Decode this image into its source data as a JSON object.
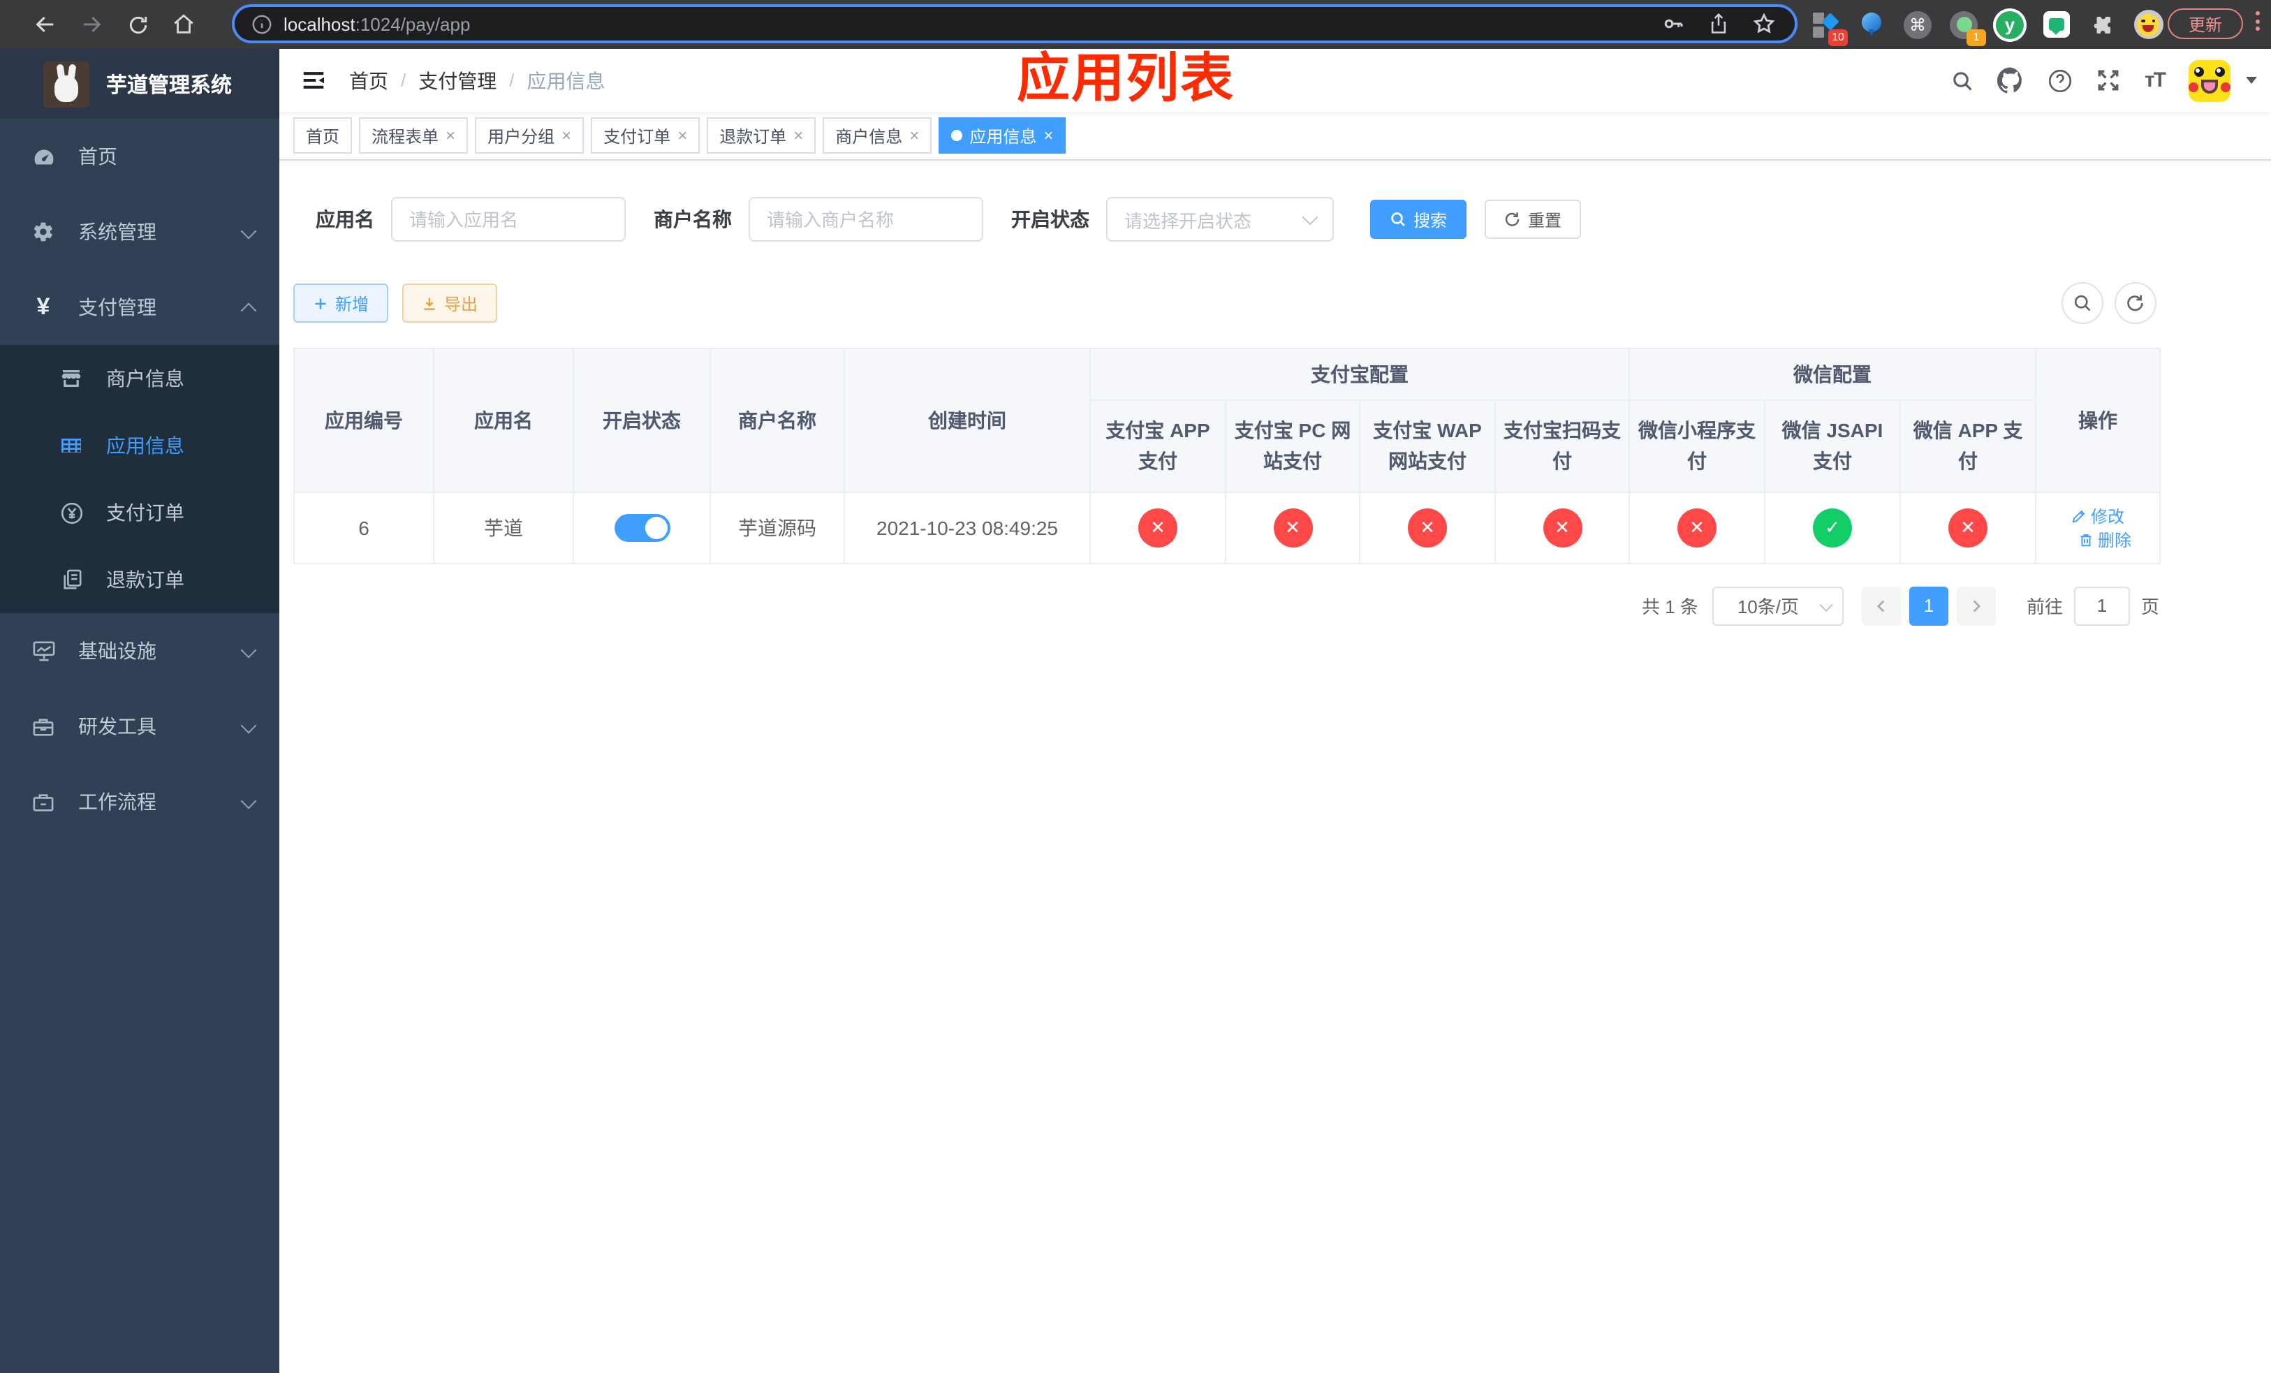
{
  "colors": {
    "accent": "#409eff",
    "success": "#13ce66",
    "danger": "#ff4949",
    "warning": "#e6a23c",
    "annotation_red": "#ff2b00",
    "sidebar_bg": "#304156",
    "submenu_bg": "#1f2d3d"
  },
  "icons": {
    "close": "×",
    "check": "✓",
    "cross": "✕",
    "cmd": "⌘",
    "y_logo": "y",
    "yuan": "¥",
    "question": "?",
    "font_size": "тT",
    "info": "i"
  },
  "browser": {
    "url": {
      "host": "localhost",
      "path": ":1024/pay/app"
    },
    "update_button": "更新",
    "extension_badge_1": "10",
    "extension_badge_2": "1"
  },
  "sidebar": {
    "title": "芋道管理系统",
    "items": [
      {
        "label": "首页"
      },
      {
        "label": "系统管理"
      },
      {
        "label": "支付管理"
      },
      {
        "label": "商户信息"
      },
      {
        "label": "应用信息"
      },
      {
        "label": "支付订单"
      },
      {
        "label": "退款订单"
      },
      {
        "label": "基础设施"
      },
      {
        "label": "研发工具"
      },
      {
        "label": "工作流程"
      }
    ]
  },
  "navbar": {
    "breadcrumb": [
      "首页",
      "支付管理",
      "应用信息"
    ],
    "separator": "/"
  },
  "annotation": "应用列表",
  "tabs": [
    {
      "label": "首页"
    },
    {
      "label": "流程表单"
    },
    {
      "label": "用户分组"
    },
    {
      "label": "支付订单"
    },
    {
      "label": "退款订单"
    },
    {
      "label": "商户信息"
    },
    {
      "label": "应用信息"
    }
  ],
  "search": {
    "app_name_label": "应用名",
    "app_name_placeholder": "请输入应用名",
    "merchant_label": "商户名称",
    "merchant_placeholder": "请输入商户名称",
    "status_label": "开启状态",
    "status_placeholder": "请选择开启状态",
    "search_button": "搜索",
    "reset_button": "重置"
  },
  "toolbar": {
    "add_button": "新增",
    "export_button": "导出"
  },
  "table": {
    "group_alipay": "支付宝配置",
    "group_wechat": "微信配置",
    "columns": [
      "应用编号",
      "应用名",
      "开启状态",
      "商户名称",
      "创建时间",
      "支付宝 APP 支付",
      "支付宝 PC 网站支付",
      "支付宝 WAP 网站支付",
      "支付宝扫码支付",
      "微信小程序支付",
      "微信 JSAPI 支付",
      "微信 APP 支付",
      "操作"
    ],
    "row": {
      "app_id": "6",
      "app_name": "芋道",
      "merchant_name": "芋道源码",
      "create_time": "2021-10-23 08:49:25",
      "channel_status": [
        "✕",
        "✕",
        "✕",
        "✕",
        "✕",
        "✓",
        "✕"
      ],
      "edit": "修改",
      "delete": "删除"
    }
  },
  "pagination": {
    "total": "共 1 条",
    "page_size": "10条/页",
    "page": "1",
    "goto_label": "前往",
    "goto_value": "1",
    "page_unit": "页"
  }
}
